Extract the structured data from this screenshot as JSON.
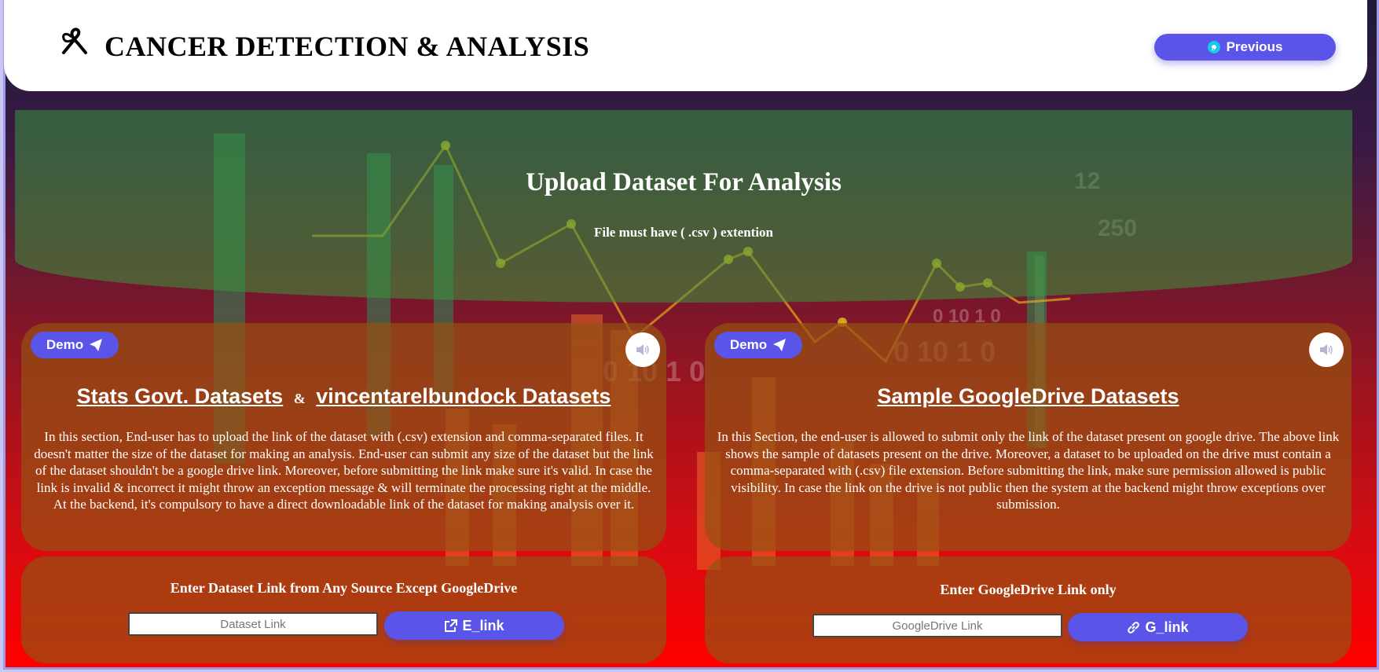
{
  "header": {
    "title": "CANCER DETECTION & ANALYSIS",
    "previous_label": "Previous"
  },
  "banner": {
    "title": "Upload Dataset For Analysis",
    "subtitle": "File must have ( .csv ) extention"
  },
  "left_card": {
    "demo_label": "Demo",
    "link1": "Stats Govt. Datasets",
    "amp": "&",
    "link2": "vincentarelbundock Datasets",
    "description": "In this section, End-user has to upload the link of the dataset with (.csv) extension and comma-separated files. It doesn't matter the size of the dataset for making an analysis. End-user can submit any size of the dataset but the link of the dataset shouldn't be a google drive link. Moreover, before submitting the link make sure it's valid. In case the link is invalid & incorrect it might throw an exception message & will terminate the processing right at the middle. At the backend, it's compulsory to have a direct downloadable link of the dataset for making analysis over it."
  },
  "right_card": {
    "demo_label": "Demo",
    "link": "Sample GoogleDrive Datasets",
    "description": "In this Section, the end-user is allowed to submit only the link of the dataset present on google drive. The above link shows the sample of datasets present on the drive. Moreover, a dataset to be uploaded on the drive must contain a comma-separated with (.csv) file extension. Before submitting the link, make sure permission allowed is public visibility. In case the link on the drive is not public then the system at the backend might throw exceptions over submission."
  },
  "left_form": {
    "label": "Enter Dataset Link from Any Source Except GoogleDrive",
    "placeholder": "Dataset Link",
    "value": "",
    "button_label": "E_link"
  },
  "right_form": {
    "label": "Enter GoogleDrive Link only",
    "placeholder": "GoogleDrive Link",
    "value": "",
    "button_label": "G_link"
  },
  "colors": {
    "accent": "#5a55e8",
    "banner": "#3c963c",
    "card": "#965014"
  },
  "icons": {
    "logo": "ribbon-icon",
    "previous": "return-arrow-icon",
    "demo": "paper-plane-icon",
    "speaker": "speaker-icon",
    "e_link": "external-link-icon",
    "g_link": "chain-link-icon"
  }
}
